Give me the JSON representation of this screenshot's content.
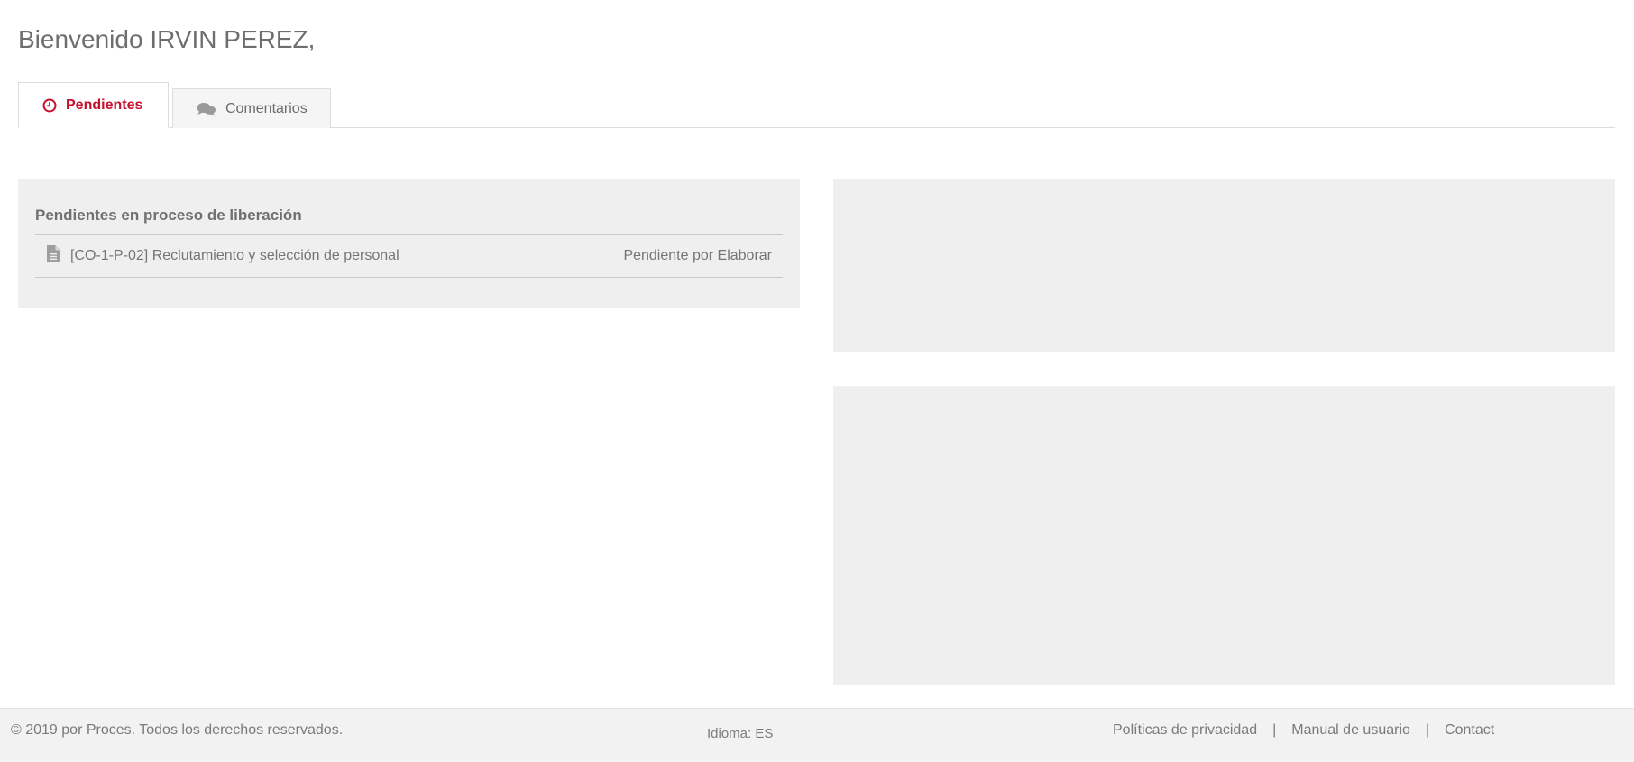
{
  "header": {
    "welcome": "Bienvenido IRVIN PEREZ,"
  },
  "tabs": [
    {
      "label": "Pendientes",
      "icon": "clock-icon",
      "active": true
    },
    {
      "label": "Comentarios",
      "icon": "comments-icon",
      "active": false
    }
  ],
  "pending_panel": {
    "title": "Pendientes en proceso de liberación",
    "items": [
      {
        "icon": "document-icon",
        "title": "[CO-1-P-02] Reclutamiento y selección de personal",
        "status": "Pendiente por Elaborar"
      }
    ]
  },
  "footer": {
    "copyright": "© 2019 por Proces. Todos los derechos reservados.",
    "language": "Idioma: ES",
    "links": [
      {
        "label": "Políticas de privacidad"
      },
      {
        "label": "Manual de usuario"
      },
      {
        "label": "Contact"
      }
    ],
    "separator": "|"
  },
  "colors": {
    "accent": "#c8102e",
    "panel_bg": "#efefef",
    "footer_bg": "#f2f2f2"
  }
}
